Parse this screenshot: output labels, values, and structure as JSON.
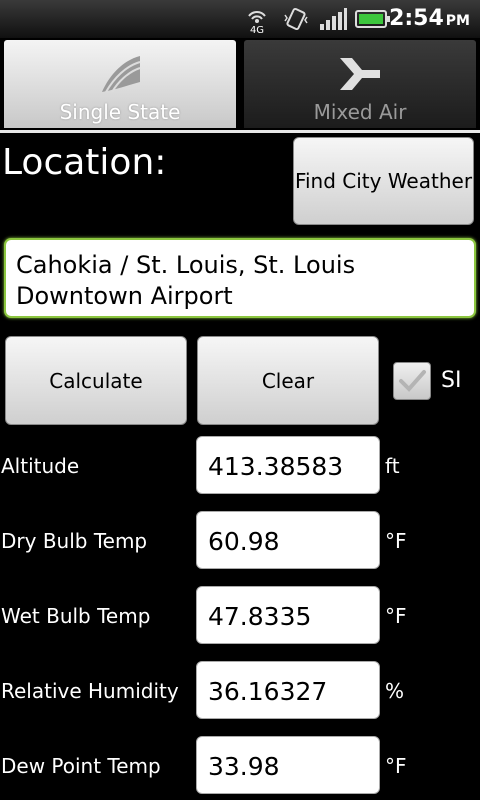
{
  "status_bar": {
    "network": "4G",
    "time": "2:54",
    "ampm": "PM",
    "icons": [
      "4g-signal-icon",
      "vibrate-icon",
      "signal-bars-icon",
      "battery-icon"
    ]
  },
  "tabs": [
    {
      "label": "Single State",
      "icon": "single-state-icon",
      "active": true
    },
    {
      "label": "Mixed Air",
      "icon": "mixed-air-icon",
      "active": false
    }
  ],
  "location": {
    "label": "Location:",
    "find_button": "Find City Weather",
    "value": "Cahokia / St. Louis, St. Louis Downtown Airport"
  },
  "actions": {
    "calculate": "Calculate",
    "clear": "Clear",
    "si_label": "SI",
    "si_checked": true
  },
  "fields": [
    {
      "label": "Altitude",
      "value": "413.38583",
      "unit": "ft"
    },
    {
      "label": "Dry Bulb Temp",
      "value": "60.98",
      "unit": "°F"
    },
    {
      "label": "Wet Bulb Temp",
      "value": "47.8335",
      "unit": "°F"
    },
    {
      "label": "Relative Humidity",
      "value": "36.16327",
      "unit": "%"
    },
    {
      "label": "Dew Point Temp",
      "value": "33.98",
      "unit": "°F"
    }
  ],
  "colors": {
    "focus_border": "#8cc63f",
    "background": "#000000"
  }
}
